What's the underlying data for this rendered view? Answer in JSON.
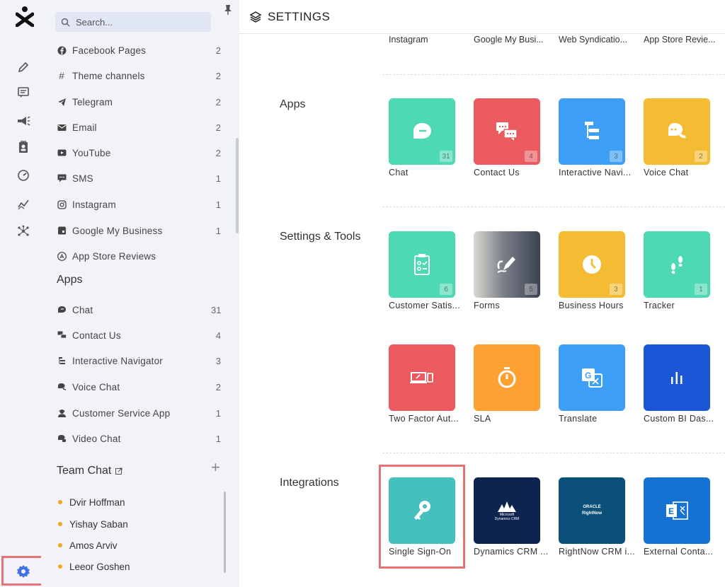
{
  "search": {
    "placeholder": "Search..."
  },
  "channels": [
    {
      "label": "Facebook Pages",
      "count": "2",
      "icon": "facebook-icon"
    },
    {
      "label": "Theme channels",
      "count": "2",
      "icon": "hash-icon"
    },
    {
      "label": "Telegram",
      "count": "2",
      "icon": "telegram-icon"
    },
    {
      "label": "Email",
      "count": "2",
      "icon": "email-icon"
    },
    {
      "label": "YouTube",
      "count": "2",
      "icon": "youtube-icon"
    },
    {
      "label": "SMS",
      "count": "1",
      "icon": "sms-icon"
    },
    {
      "label": "Instagram",
      "count": "1",
      "icon": "instagram-icon"
    },
    {
      "label": "Google My Business",
      "count": "1",
      "icon": "google-business-icon"
    },
    {
      "label": "App Store Reviews",
      "count": "",
      "icon": "app-store-icon"
    }
  ],
  "apps_section": {
    "title": "Apps"
  },
  "apps": [
    {
      "label": "Chat",
      "count": "31",
      "icon": "chat-icon"
    },
    {
      "label": "Contact Us",
      "count": "4",
      "icon": "contact-icon"
    },
    {
      "label": "Interactive Navigator",
      "count": "3",
      "icon": "navigator-icon"
    },
    {
      "label": "Voice Chat",
      "count": "2",
      "icon": "voice-chat-icon"
    },
    {
      "label": "Customer Service App",
      "count": "1",
      "icon": "customer-service-icon"
    },
    {
      "label": "Video Chat",
      "count": "1",
      "icon": "video-chat-icon"
    }
  ],
  "team_chat": {
    "title": "Team Chat",
    "members": [
      "Dvir Hoffman",
      "Yishay Saban",
      "Amos Arviv",
      "Leeor Goshen"
    ],
    "presence_color": "#f5a623"
  },
  "main": {
    "title": "SETTINGS",
    "top_labels": [
      "Instagram",
      "Google My Busi...",
      "Web Syndicatio...",
      "App Store Revie..."
    ],
    "categories": {
      "apps": "Apps",
      "settings_tools": "Settings & Tools",
      "integrations": "Integrations"
    },
    "app_tiles": [
      {
        "label": "Chat",
        "badge": "31",
        "color": "#4dd9b3",
        "icon": "chat-bubble-icon"
      },
      {
        "label": "Contact Us",
        "badge": "4",
        "color": "#ea5a5f",
        "icon": "contact-bubbles-icon"
      },
      {
        "label": "Interactive Navi...",
        "badge": "3",
        "color": "#3d9ff5",
        "icon": "hierarchy-icon"
      },
      {
        "label": "Voice Chat",
        "badge": "2",
        "color": "#f4bc33",
        "icon": "voice-chat-icon"
      }
    ],
    "tools_tiles": [
      {
        "label": "Customer Satis...",
        "badge": "6",
        "color": "#4dd9b3",
        "icon": "clipboard-icon"
      },
      {
        "label": "Forms",
        "badge": "5",
        "color": "#5a5f6a",
        "icon": "pen-icon"
      },
      {
        "label": "Business Hours",
        "badge": "3",
        "color": "#f4bc33",
        "icon": "clock-icon"
      },
      {
        "label": "Tracker",
        "badge": "1",
        "color": "#4dd9b3",
        "icon": "footprints-icon"
      },
      {
        "label": "Two Factor Aut...",
        "badge": "",
        "color": "#ea5a5f",
        "icon": "two-factor-icon"
      },
      {
        "label": "SLA",
        "badge": "",
        "color": "#ffa033",
        "icon": "stopwatch-icon"
      },
      {
        "label": "Translate",
        "badge": "",
        "color": "#3d9ff5",
        "icon": "translate-icon"
      },
      {
        "label": "Custom BI Das...",
        "badge": "",
        "color": "#1a56d6",
        "icon": "bar-chart-icon"
      }
    ],
    "integration_tiles": [
      {
        "label": "Single Sign-On",
        "badge": "",
        "color": "#45c1bd",
        "icon": "key-icon",
        "tile_text": ""
      },
      {
        "label": "Dynamics CRM ...",
        "badge": "",
        "color": "#0d2350",
        "icon": "microsoft-dynamics-icon",
        "tile_text": "Microsoft Dynamics CRM"
      },
      {
        "label": "RightNow CRM i...",
        "badge": "",
        "color": "#0a5078",
        "icon": "oracle-rightnow-icon",
        "tile_text": "ORACLE RightNow"
      },
      {
        "label": "External Conta...",
        "badge": "",
        "color": "#1672d2",
        "icon": "exchange-icon",
        "tile_text": "E"
      }
    ]
  }
}
